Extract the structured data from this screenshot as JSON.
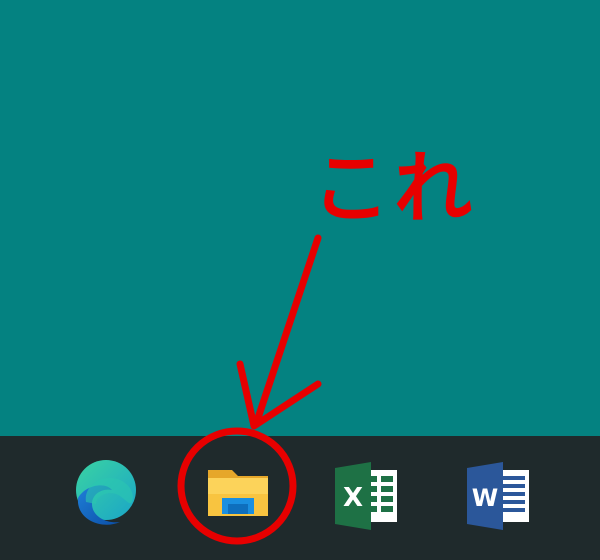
{
  "annotation": {
    "callout_text": "これ",
    "color": "#e70000"
  },
  "desktop": {
    "background_color": "#048281"
  },
  "taskbar": {
    "background_color": "#1f2a2c",
    "items": [
      {
        "icon": "edge-icon"
      },
      {
        "icon": "file-explorer-icon",
        "highlighted": true
      },
      {
        "icon": "excel-icon",
        "glyph": "X"
      },
      {
        "icon": "word-icon",
        "glyph": "W"
      }
    ]
  }
}
